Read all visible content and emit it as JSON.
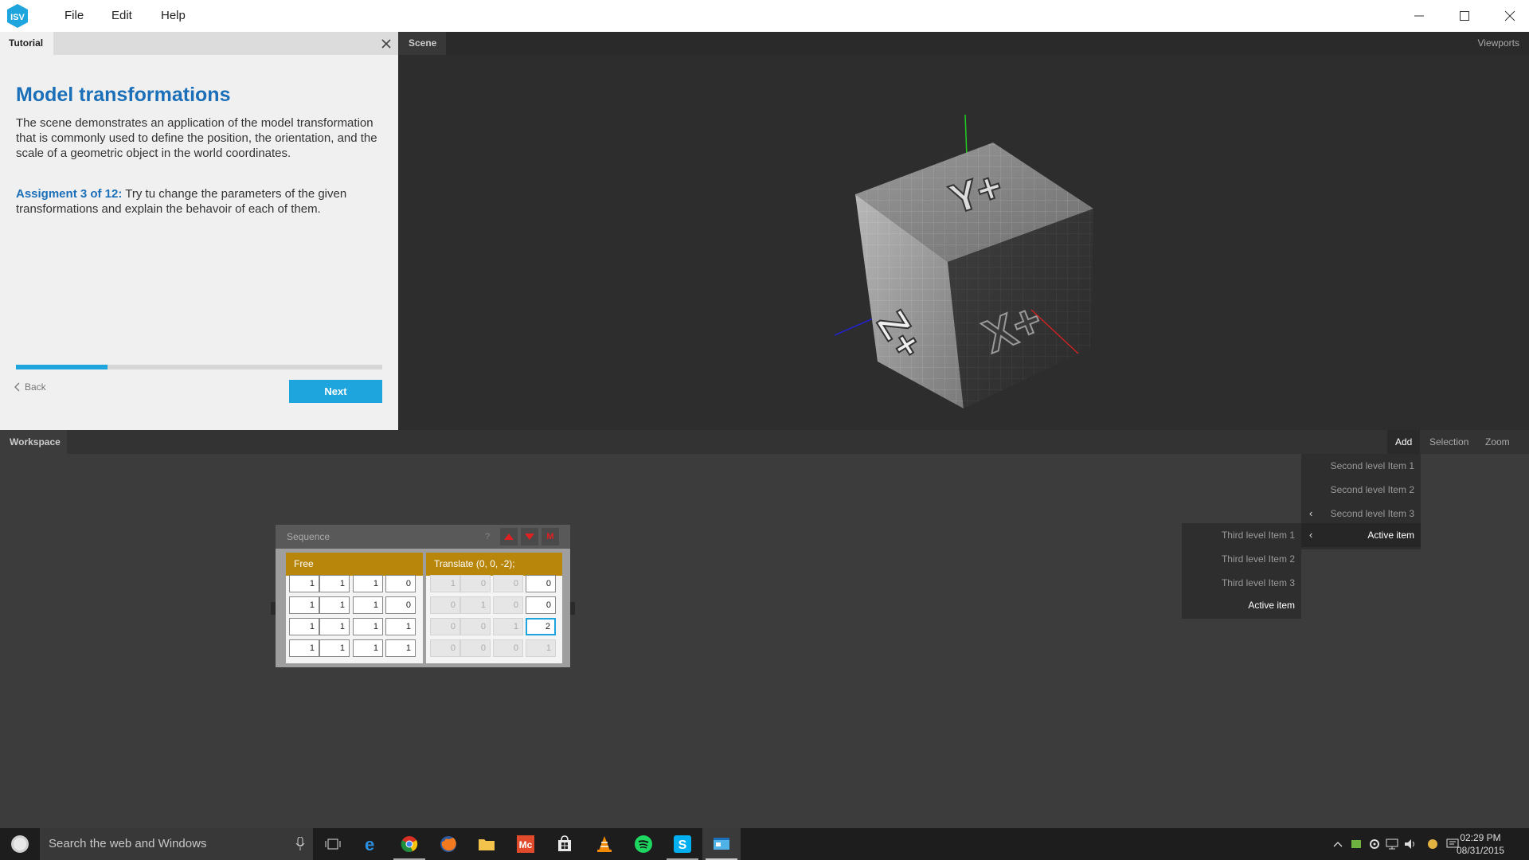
{
  "app": {
    "logo_text": "ISV",
    "menu": [
      "File",
      "Edit",
      "Help"
    ]
  },
  "tutorial": {
    "tab_label": "Tutorial",
    "title": "Model transformations",
    "body": "The scene demonstrates an application of the model transformation that is commonly used to define the position, the orientation, and the scale of a geometric object in the world coordinates.",
    "assignment_label": "Assigment 3 of 12:",
    "assignment_text": " Try tu change the parameters of the given transformations and explain the behavoir of each of them.",
    "progress": 0.25,
    "back_label": "Back",
    "next_label": "Next"
  },
  "scene": {
    "tab_label": "Scene",
    "viewports_label": "Viewports",
    "cube_face_labels": [
      "Y+",
      "Z+",
      "X+"
    ]
  },
  "workspace": {
    "tab_label": "Workspace",
    "menu": [
      "Add",
      "Selection",
      "Zoom"
    ],
    "second_level": [
      "Second level Item 1",
      "Second level Item 2",
      "Second level Item 3",
      "Active item"
    ],
    "third_level": [
      "Third level Item 1",
      "Third level Item 2",
      "Third level Item 3",
      "Active item"
    ]
  },
  "sequence": {
    "title": "Sequence",
    "help": "?",
    "m_label": "M",
    "free": {
      "label": "Free",
      "rows": [
        [
          "1",
          "1",
          "1",
          "0"
        ],
        [
          "1",
          "1",
          "1",
          "0"
        ],
        [
          "1",
          "1",
          "1",
          "1"
        ],
        [
          "1",
          "1",
          "1",
          "1"
        ]
      ]
    },
    "translate": {
      "label": "Translate (0, 0, -2);",
      "rows": [
        [
          "1",
          "0",
          "0",
          "0"
        ],
        [
          "0",
          "1",
          "0",
          "0"
        ],
        [
          "0",
          "0",
          "1",
          "2"
        ],
        [
          "0",
          "0",
          "0",
          "1"
        ]
      ]
    }
  },
  "taskbar": {
    "search_placeholder": "Search the web and Windows",
    "time": "02:29 PM",
    "date": "08/31/2015"
  },
  "colors": {
    "accent": "#1fa5dd",
    "title_blue": "#1a6fb8",
    "card_header": "#b8860b",
    "arrow_red": "#e02020"
  }
}
